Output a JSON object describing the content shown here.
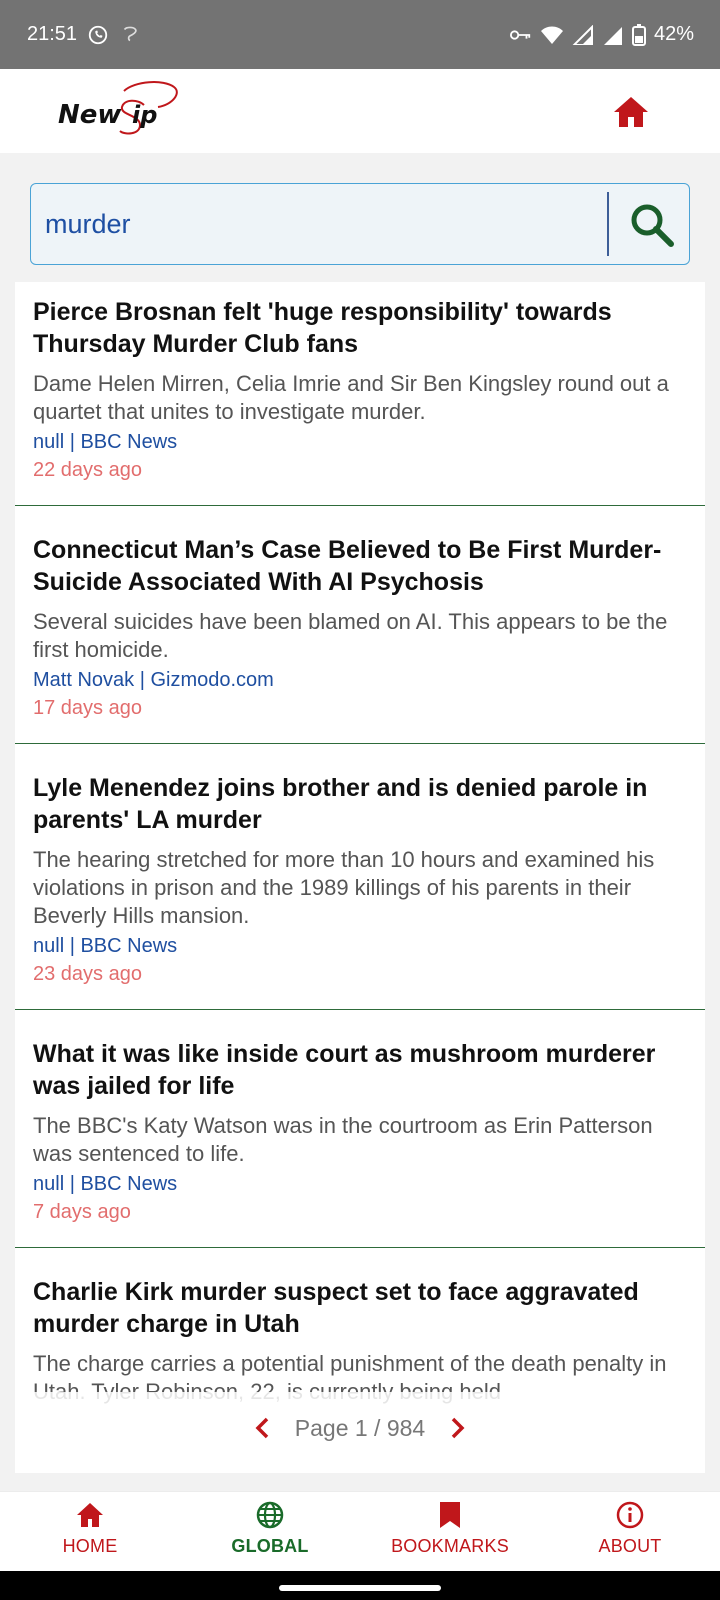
{
  "status_bar": {
    "time": "21:51",
    "battery": "42%",
    "icons": [
      "whatsapp-icon",
      "notification-icon",
      "vpn-key-icon",
      "wifi-icon",
      "signal-icon",
      "signal-icon",
      "battery-icon"
    ]
  },
  "app_bar": {
    "logo_text": "NewSip",
    "home_icon": "home-icon"
  },
  "search": {
    "value": "murder",
    "icon": "search-icon"
  },
  "articles": [
    {
      "title": "Pierce Brosnan felt 'huge responsibility' towards Thursday Murder Club fans",
      "description": "Dame Helen Mirren, Celia Imrie and Sir Ben Kingsley round out a quartet that unites to investigate murder.",
      "source": "null | BBC News",
      "time": "22 days ago"
    },
    {
      "title": "Connecticut Man’s Case Believed to Be First Murder-Suicide Associated With AI Psychosis",
      "description": "Several suicides have been blamed on AI. This appears to be the first homicide.",
      "source": "Matt Novak | Gizmodo.com",
      "time": "17 days ago"
    },
    {
      "title": "Lyle Menendez joins brother and is denied parole in parents' LA murder",
      "description": "The hearing stretched for more than 10 hours and examined his violations in prison and the 1989 killings of his parents in their Beverly Hills mansion.",
      "source": "null | BBC News",
      "time": "23 days ago"
    },
    {
      "title": "What it was like inside court as mushroom murderer was jailed for life",
      "description": "The BBC's Katy Watson was in the courtroom as Erin Patterson was sentenced to life.",
      "source": "null | BBC News",
      "time": "7 days ago"
    },
    {
      "title": "Charlie Kirk murder suspect set to face aggravated murder charge in Utah",
      "description": "The charge carries a potential punishment of the death penalty in Utah. Tyler Robinson, 22, is currently being held",
      "source": "",
      "time": ""
    }
  ],
  "pagination": {
    "label": "Page 1 / 984",
    "prev_icon": "chevron-left-icon",
    "next_icon": "chevron-right-icon"
  },
  "bottom_nav": {
    "items": [
      {
        "label": "HOME",
        "icon": "home-icon"
      },
      {
        "label": "GLOBAL",
        "icon": "globe-icon"
      },
      {
        "label": "BOOKMARKS",
        "icon": "bookmark-icon"
      },
      {
        "label": "ABOUT",
        "icon": "info-icon"
      }
    ],
    "active": "GLOBAL"
  },
  "colors": {
    "accent_red": "#c0171b",
    "accent_green": "#1a6b2a",
    "link_blue": "#1f4fa0",
    "time_red": "#e26d6d",
    "status_bar": "#737373"
  }
}
